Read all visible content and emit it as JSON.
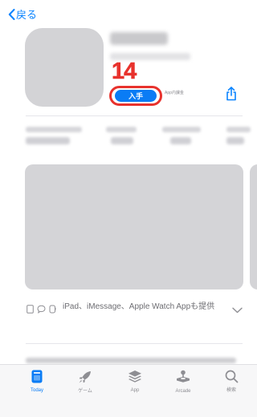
{
  "nav": {
    "back_label": "戻る",
    "back_icon": "chevron-left-icon"
  },
  "app": {
    "get_button_label": "入手",
    "in_app_purchase_note": "App内課金",
    "share_icon": "share-icon"
  },
  "annotation": {
    "step_number": "14"
  },
  "devices": {
    "icons": [
      "iphone-icon",
      "imessage-icon",
      "apple-watch-icon"
    ],
    "text": "iPad、iMessage、Apple Watch Appも提供"
  },
  "tabbar": {
    "items": [
      {
        "label": "Today",
        "icon": "today-icon",
        "active": true
      },
      {
        "label": "ゲーム",
        "icon": "rocket-icon",
        "active": false
      },
      {
        "label": "App",
        "icon": "layers-icon",
        "active": false
      },
      {
        "label": "Arcade",
        "icon": "joystick-icon",
        "active": false
      },
      {
        "label": "検索",
        "icon": "search-icon",
        "active": false
      }
    ]
  },
  "colors": {
    "accent": "#0a7cf5",
    "annotation_red": "#e8322d",
    "placeholder_gray": "#d4d4d7"
  }
}
